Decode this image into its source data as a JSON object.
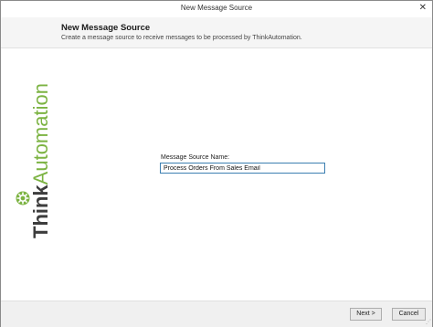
{
  "window": {
    "title": "New Message Source",
    "close_glyph": "✕"
  },
  "header": {
    "title": "New Message Source",
    "subtitle": "Create a message source to receive messages to be processed by ThinkAutomation."
  },
  "logo": {
    "text_dark": "Think",
    "text_light": "Automation",
    "icon": "gear-icon"
  },
  "form": {
    "label": "Message Source Name:",
    "value": "Process Orders From Sales Email",
    "placeholder": ""
  },
  "footer": {
    "next_label": "Next >",
    "cancel_label": "Cancel"
  },
  "colors": {
    "brand_green": "#7cb342",
    "logo_gray": "#3d3d3d",
    "input_focus": "#3c7fb1"
  }
}
